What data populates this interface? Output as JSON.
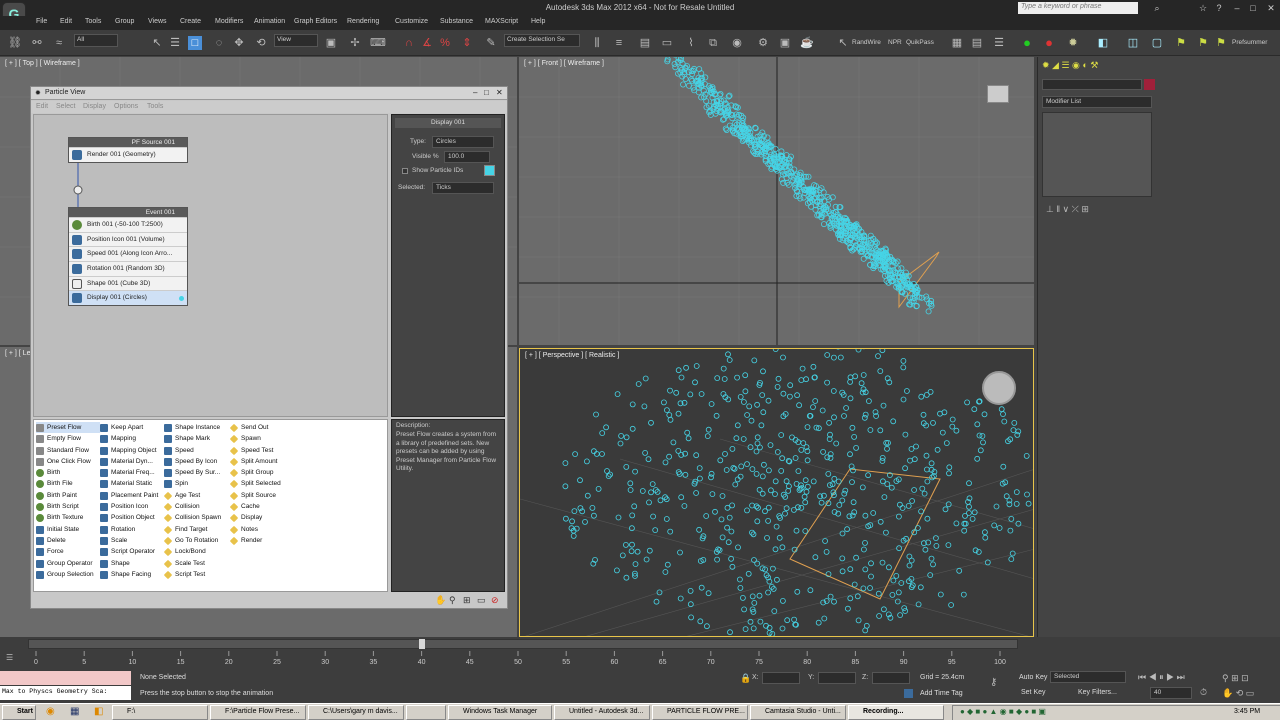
{
  "window": {
    "title": "Autodesk 3ds Max  2012 x64    -  Not for Resale   Untitled"
  },
  "search": {
    "placeholder": "Type a keyword or phrase"
  },
  "menu": [
    "File",
    "Edit",
    "Tools",
    "Group",
    "Views",
    "Create",
    "Modifiers",
    "Animation",
    "Graph Editors",
    "Rendering",
    "Customize",
    "Substance",
    "MAXScript",
    "Help"
  ],
  "toolbar": {
    "selection_filter": "All",
    "reference_coord": "View",
    "named_selection": "Create Selection Se",
    "render_labels": [
      "RandWire",
      "NPR",
      "QuikPass"
    ],
    "right_label": "Prefsummer"
  },
  "viewports": {
    "top": "[ + ] [ Top ] [ Wireframe ]",
    "left": "[ + ] [ Le",
    "front": "[ + ] [ Front ] [ Wireframe ]",
    "perspective": "[ + ] [ Perspective ] [ Realistic ]"
  },
  "command_panel": {
    "modifier_list": "Modifier List"
  },
  "particle_view": {
    "title": "Particle View",
    "menu": [
      "Edit",
      "Select",
      "Display",
      "Options",
      "Tools"
    ],
    "source_node": {
      "title": "PF Source 001",
      "ops": [
        "Render 001 (Geometry)"
      ]
    },
    "event_node": {
      "title": "Event 001",
      "ops": [
        "Birth 001 (-50-100 T:2500)",
        "Position Icon 001 (Volume)",
        "Speed 001 (Along Icon Arro...",
        "Rotation 001 (Random 3D)",
        "Shape 001 (Cube 3D)",
        "Display 001 (Circles)"
      ]
    },
    "props": {
      "rollout": "Display 001",
      "type_label": "Type:",
      "type_value": "Circles",
      "visible_label": "Visible %",
      "visible_value": "100.0",
      "show_ids": "Show Particle IDs",
      "selected_label": "Selected:",
      "selected_value": "Ticks"
    },
    "depot": {
      "col1": [
        "Preset Flow",
        "Empty Flow",
        "Standard Flow",
        "One Click Flow",
        "Birth",
        "Birth File",
        "Birth Paint",
        "Birth Script",
        "Birth Texture",
        "Initial State",
        "Delete",
        "Force",
        "Group Operator",
        "Group Selection"
      ],
      "col2": [
        "Keep Apart",
        "Mapping",
        "Mapping Object",
        "Material Dyn...",
        "Material Freq...",
        "Material Static",
        "Placement Paint",
        "Position Icon",
        "Position Object",
        "Rotation",
        "Scale",
        "Script Operator",
        "Shape",
        "Shape Facing"
      ],
      "col3": [
        "Shape Instance",
        "Shape Mark",
        "Speed",
        "Speed By Icon",
        "Speed By Sur...",
        "Spin",
        "Age Test",
        "Collision",
        "Collision Spawn",
        "Find Target",
        "Go To Rotation",
        "Lock/Bond",
        "Scale Test",
        "Script Test"
      ],
      "col4": [
        "Send Out",
        "Spawn",
        "Speed Test",
        "Split Amount",
        "Split Group",
        "Split Selected",
        "Split Source",
        "Cache",
        "Display",
        "Notes",
        "Render"
      ]
    },
    "description": {
      "label": "Description:",
      "text": "Preset Flow creates a system from a library of predefined sets. New presets can be added by using Preset Manager from Particle Flow Utility."
    }
  },
  "timeline": {
    "ticks": [
      "0",
      "5",
      "10",
      "15",
      "20",
      "25",
      "30",
      "35",
      "40",
      "45",
      "50",
      "55",
      "60",
      "65",
      "70",
      "75",
      "80",
      "85",
      "90",
      "95",
      "100"
    ],
    "current_frame": 40
  },
  "status": {
    "maxscript": "Max to Physcs Geometry Sca:",
    "selection": "None Selected",
    "prompt": "Press the stop button to stop the animation",
    "x_label": "X:",
    "y_label": "Y:",
    "z_label": "Z:",
    "grid": "Grid = 25.4cm",
    "add_time_tag": "Add Time Tag",
    "auto_key": "Auto Key",
    "set_key": "Set Key",
    "key_mode": "Selected",
    "key_filters": "Key Filters...",
    "frame_field": "40"
  },
  "taskbar": {
    "start": "Start",
    "items": [
      "F:\\",
      "F:\\Particle Flow Prese...",
      "C:\\Users\\gary m davis...",
      "",
      "Windows Task Manager",
      "Untitled - Autodesk 3d...",
      "PARTICLE FLOW PRE...",
      "Camtasia Studio - Unti...",
      "Recording..."
    ],
    "clock": "3:45 PM"
  },
  "colors": {
    "particle": "#46d4e6",
    "emitter": "#e0a050",
    "active_border": "#e8c54a"
  }
}
